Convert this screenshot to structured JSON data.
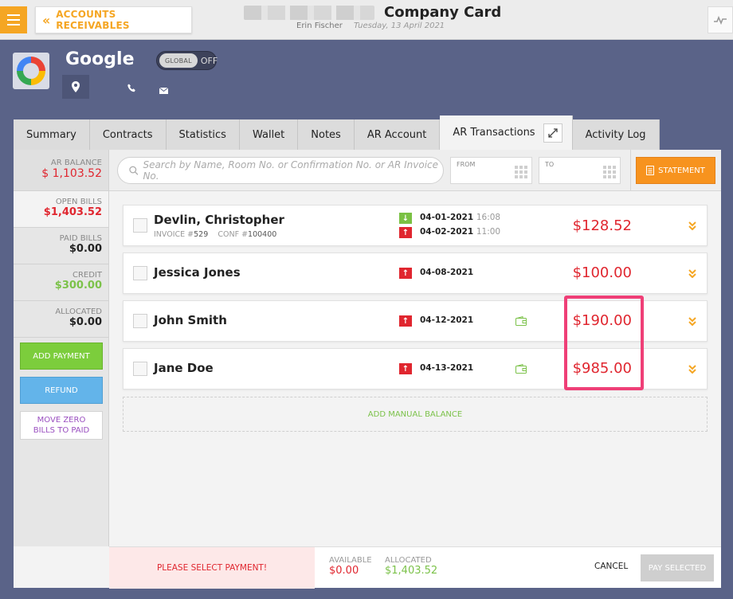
{
  "topbar": {
    "back_label": "ACCOUNTS RECEIVABLES",
    "title": "Company Card",
    "user": "Erin Fischer",
    "date": "Tuesday, 13 April 2021"
  },
  "profile": {
    "company": "Google",
    "global_label": "GLOBAL",
    "global_state": "OFF"
  },
  "tabs": [
    {
      "label": "Summary"
    },
    {
      "label": "Contracts"
    },
    {
      "label": "Statistics"
    },
    {
      "label": "Wallet"
    },
    {
      "label": "Notes"
    },
    {
      "label": "AR Account"
    },
    {
      "label": "AR Transactions"
    },
    {
      "label": "Activity Log"
    }
  ],
  "sidebar": {
    "ar_balance_label": "AR BALANCE",
    "ar_balance": "$ 1,103.52",
    "open_bills_label": "OPEN BILLS",
    "open_bills": "$1,403.52",
    "paid_bills_label": "PAID BILLS",
    "paid_bills": "$0.00",
    "credit_label": "CREDIT",
    "credit": "$300.00",
    "allocated_label": "ALLOCATED",
    "allocated": "$0.00",
    "add_payment": "ADD PAYMENT",
    "refund": "REFUND",
    "move_zero_line1": "MOVE ZERO",
    "move_zero_line2": "BILLS TO PAID"
  },
  "filter": {
    "search_placeholder": "Search by Name, Room No. or Confirmation No. or AR Invoice No.",
    "from_label": "FROM",
    "to_label": "TO",
    "statement": "STATEMENT"
  },
  "bills": [
    {
      "name": "Devlin, Christopher",
      "invoice_label": "INVOICE #",
      "invoice": "529",
      "conf_label": "CONF #",
      "conf": "100400",
      "date1": "04-01-2021",
      "time1": "16:08",
      "date2": "04-02-2021",
      "time2": "11:00",
      "amount": "$128.52"
    },
    {
      "name": "Jessica Jones",
      "date": "04-08-2021",
      "amount": "$100.00"
    },
    {
      "name": "John Smith",
      "date": "04-12-2021",
      "amount": "$190.00"
    },
    {
      "name": "Jane Doe",
      "date": "04-13-2021",
      "amount": "$985.00"
    }
  ],
  "manual_balance": "ADD MANUAL BALANCE",
  "footer": {
    "select_payment": "PLEASE SELECT PAYMENT!",
    "available_label": "AVAILABLE",
    "available": "$0.00",
    "allocated_label": "ALLOCATED",
    "allocated": "$1,403.52",
    "cancel": "CANCEL",
    "pay_selected": "PAY SELECTED"
  },
  "colors": {
    "accent_orange": "#f5a623",
    "negative_red": "#e0262f",
    "positive_green": "#7cc24a",
    "highlight_pink": "#ef3f77"
  }
}
